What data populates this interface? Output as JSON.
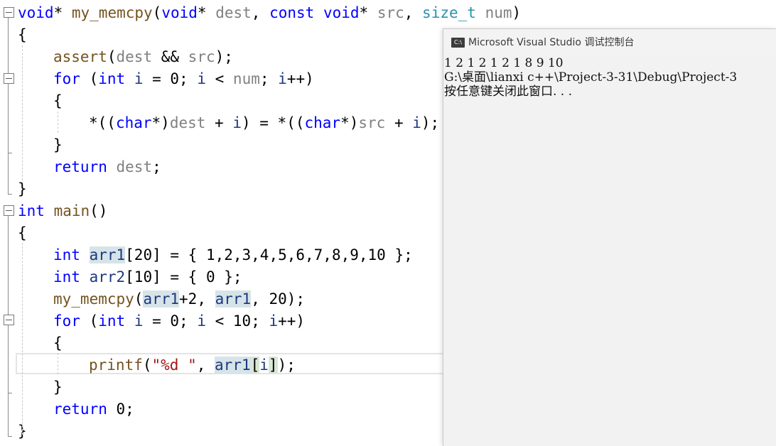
{
  "editor": {
    "lines": [
      {
        "tokens": [
          [
            "kw",
            "void"
          ],
          [
            "punct",
            "* "
          ],
          [
            "fn",
            "my_memcpy"
          ],
          [
            "punct",
            "("
          ],
          [
            "kw",
            "void"
          ],
          [
            "punct",
            "* "
          ],
          [
            "param",
            "dest"
          ],
          [
            "punct",
            ", "
          ],
          [
            "kw",
            "const "
          ],
          [
            "kw",
            "void"
          ],
          [
            "punct",
            "* "
          ],
          [
            "param",
            "src"
          ],
          [
            "punct",
            ", "
          ],
          [
            "type",
            "size_t "
          ],
          [
            "param",
            "num"
          ],
          [
            "punct",
            ")"
          ]
        ]
      },
      {
        "tokens": [
          [
            "punct",
            "{"
          ]
        ]
      },
      {
        "tokens": [
          [
            "fn",
            "assert"
          ],
          [
            "punct",
            "("
          ],
          [
            "param",
            "dest"
          ],
          [
            "punct",
            " && "
          ],
          [
            "param",
            "src"
          ],
          [
            "punct",
            ");"
          ]
        ]
      },
      {
        "tokens": [
          [
            "kw",
            "for "
          ],
          [
            "punct",
            "("
          ],
          [
            "kw",
            "int "
          ],
          [
            "var",
            "i "
          ],
          [
            "punct",
            "= 0; "
          ],
          [
            "var",
            "i "
          ],
          [
            "punct",
            "< "
          ],
          [
            "param",
            "num"
          ],
          [
            "punct",
            "; "
          ],
          [
            "var",
            "i"
          ],
          [
            "punct",
            "++)"
          ]
        ]
      },
      {
        "tokens": [
          [
            "punct",
            "{"
          ]
        ]
      },
      {
        "tokens": [
          [
            "punct",
            "*(("
          ],
          [
            "kw",
            "char"
          ],
          [
            "punct",
            "*)"
          ],
          [
            "param",
            "dest "
          ],
          [
            "punct",
            "+ "
          ],
          [
            "var",
            "i"
          ],
          [
            "punct",
            ") = *(("
          ],
          [
            "kw",
            "char"
          ],
          [
            "punct",
            "*)"
          ],
          [
            "param",
            "src "
          ],
          [
            "punct",
            "+ "
          ],
          [
            "var",
            "i"
          ],
          [
            "punct",
            ");"
          ]
        ]
      },
      {
        "tokens": [
          [
            "punct",
            "}"
          ]
        ]
      },
      {
        "tokens": [
          [
            "kw",
            "return "
          ],
          [
            "param",
            "dest"
          ],
          [
            "punct",
            ";"
          ]
        ]
      },
      {
        "tokens": [
          [
            "punct",
            "}"
          ]
        ]
      },
      {
        "tokens": [
          [
            "kw",
            "int "
          ],
          [
            "fn",
            "main"
          ],
          [
            "punct",
            "()"
          ]
        ]
      },
      {
        "tokens": [
          [
            "punct",
            "{"
          ]
        ]
      },
      {
        "tokens": [
          [
            "kw",
            "int "
          ],
          [
            "var_hl",
            "arr1"
          ],
          [
            "punct",
            "[20] = { 1,2,3,4,5,6,7,8,9,10 };"
          ]
        ]
      },
      {
        "tokens": [
          [
            "kw",
            "int "
          ],
          [
            "var",
            "arr2"
          ],
          [
            "punct",
            "[10] = { 0 };"
          ]
        ]
      },
      {
        "tokens": [
          [
            "fn",
            "my_memcpy"
          ],
          [
            "punct",
            "("
          ],
          [
            "var_hl",
            "arr1"
          ],
          [
            "punct",
            "+2, "
          ],
          [
            "var_hl",
            "arr1"
          ],
          [
            "punct",
            ", 20);"
          ]
        ]
      },
      {
        "tokens": [
          [
            "kw",
            "for "
          ],
          [
            "punct",
            "("
          ],
          [
            "kw",
            "int "
          ],
          [
            "var",
            "i "
          ],
          [
            "punct",
            "= 0; "
          ],
          [
            "var",
            "i "
          ],
          [
            "punct",
            "< 10; "
          ],
          [
            "var",
            "i"
          ],
          [
            "punct",
            "++)"
          ]
        ]
      },
      {
        "tokens": [
          [
            "punct",
            "{"
          ]
        ]
      },
      {
        "tokens": [
          [
            "fn",
            "printf"
          ],
          [
            "punct",
            "("
          ],
          [
            "str",
            "\"%d \""
          ],
          [
            "punct",
            ", "
          ],
          [
            "var_hl",
            "arr1"
          ],
          [
            "punct_hl",
            "["
          ],
          [
            "var",
            "i"
          ],
          [
            "punct_hl",
            "]"
          ],
          [
            "punct",
            ");"
          ]
        ]
      },
      {
        "tokens": [
          [
            "punct",
            "}"
          ]
        ]
      },
      {
        "tokens": [
          [
            "kw",
            "return "
          ],
          [
            "punct",
            "0;"
          ]
        ]
      },
      {
        "tokens": [
          [
            "punct",
            "}"
          ]
        ]
      }
    ]
  },
  "console": {
    "title": "Microsoft Visual Studio 调试控制台",
    "icon_label": "C:\\",
    "output": [
      "1 2 1 2 1 2 1 8 9 10",
      "G:\\桌面\\lianxi c++\\Project-3-31\\Debug\\Project-3",
      "按任意键关闭此窗口. . ."
    ]
  }
}
